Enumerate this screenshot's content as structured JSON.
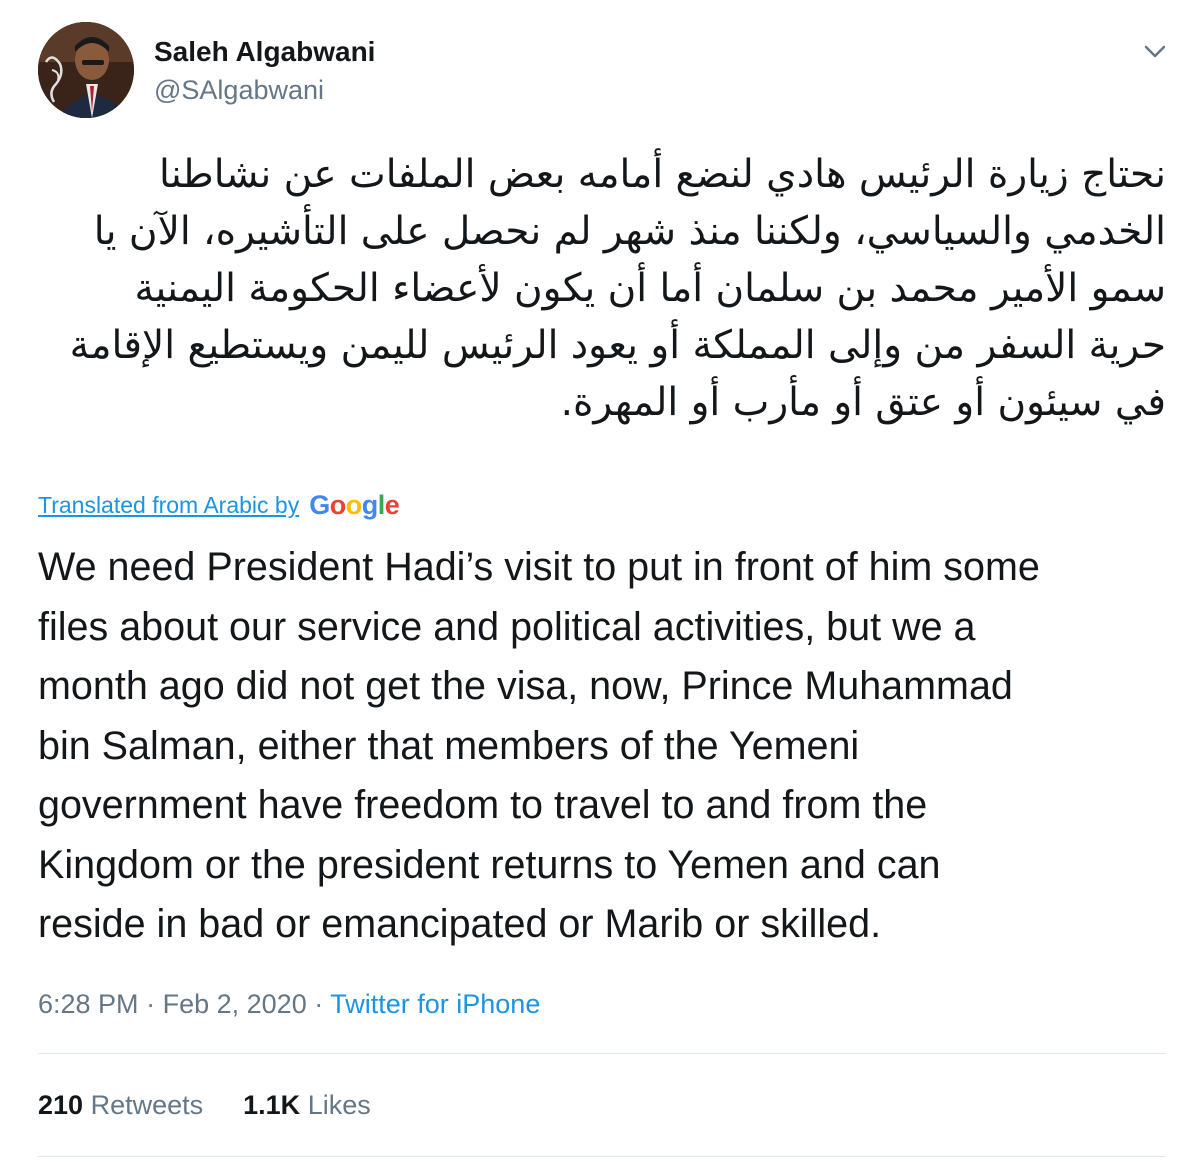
{
  "author": {
    "name": "Saleh Algabwani",
    "handle": "@SAlgabwani",
    "avatar_icon": "profile-photo"
  },
  "menu_icon": "chevron-down-icon",
  "tweet": {
    "arabic_lines": [
      "نحتاج زيارة الرئيس هادي لنضع أمامه بعض الملفات عن نشاطنا",
      "الخدمي والسياسي، ولكننا منذ شهر لم نحصل على التأشيره، الآن يا",
      "سمو الأمير محمد بن سلمان أما أن يكون لأعضاء الحكومة اليمنية",
      "حرية السفر من وإلى المملكة أو يعود الرئيس لليمن ويستطيع الإقامة",
      "في سيئون أو عتق أو مأرب أو المهرة."
    ],
    "translated_label": "Translated from Arabic by",
    "translator": "Google",
    "english_lines": [
      "We need President Hadi’s visit to put in front of him some",
      "files about our service and political activities, but we a",
      "month ago did not get the visa, now, Prince Muhammad",
      "bin Salman, either that members of the Yemeni",
      "government have freedom to travel to and from the",
      "Kingdom or the president returns to Yemen and can",
      "reside in bad or emancipated or Marib or skilled."
    ]
  },
  "meta": {
    "time": "6:28 PM",
    "separator": "·",
    "date": "Feb 2, 2020",
    "source": "Twitter for iPhone"
  },
  "stats": {
    "retweets_count": "210",
    "retweets_label": "Retweets",
    "likes_count": "1.1K",
    "likes_label": "Likes"
  },
  "colors": {
    "text": "#14171a",
    "muted": "#657786",
    "link": "#1b95e0",
    "divider": "#e1e8ed"
  }
}
